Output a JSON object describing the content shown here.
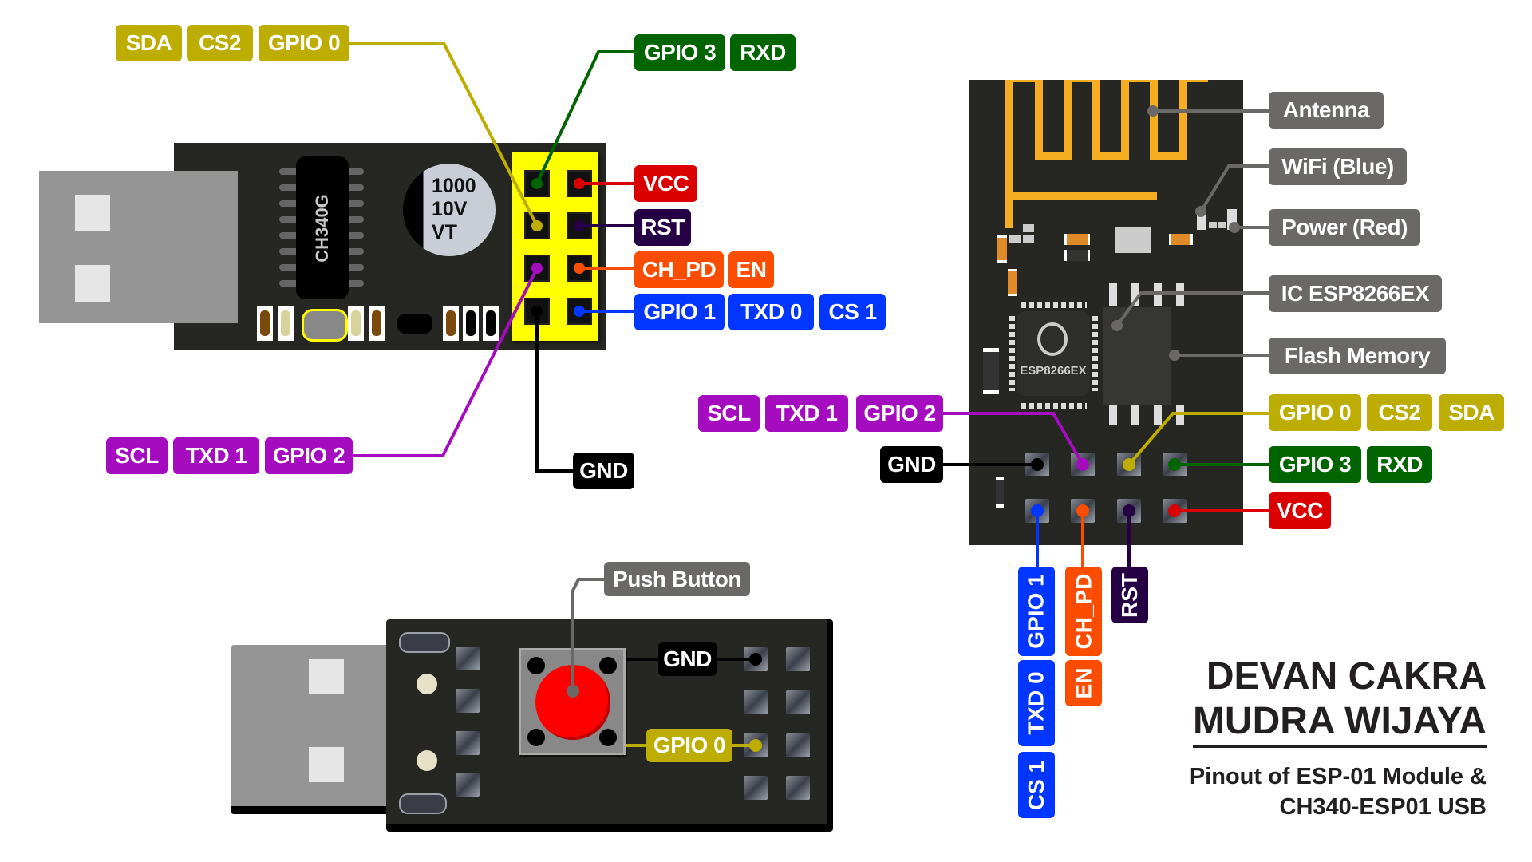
{
  "usb_adapter_top": {
    "chip_label": "CH340G",
    "capacitor_lines": [
      "1000",
      "10V",
      "VT"
    ],
    "labels": {
      "gpio0_group": [
        "SDA",
        "CS2",
        "GPIO 0"
      ],
      "gpio3_group": [
        "GPIO 3",
        "RXD"
      ],
      "vcc": "VCC",
      "rst": "RST",
      "ch_pd_group": [
        "CH_PD",
        "EN"
      ],
      "gpio1_group": [
        "GPIO 1",
        "TXD 0",
        "CS 1"
      ],
      "gpio2_group": [
        "SCL",
        "TXD 1",
        "GPIO 2"
      ],
      "gnd": "GND"
    }
  },
  "usb_adapter_bottom": {
    "labels": {
      "push_button": "Push Button",
      "gnd": "GND",
      "gpio0": "GPIO 0"
    }
  },
  "esp01": {
    "chip_marking": "ESP8266EX",
    "component_labels": {
      "antenna": "Antenna",
      "wifi_led": "WiFi (Blue)",
      "power_led": "Power (Red)",
      "ic": "IC ESP8266EX",
      "flash": "Flash Memory"
    },
    "pin_labels": {
      "gpio2_group": [
        "SCL",
        "TXD 1",
        "GPIO 2"
      ],
      "gnd": "GND",
      "gpio0_group": [
        "GPIO 0",
        "CS2",
        "SDA"
      ],
      "gpio3_group": [
        "GPIO 3",
        "RXD"
      ],
      "vcc": "VCC",
      "gpio1_group": [
        "GPIO 1",
        "TXD 0",
        "CS 1"
      ],
      "ch_pd_group": [
        "CH_PD",
        "EN"
      ],
      "rst": "RST"
    }
  },
  "credits": {
    "author_line1": "DEVAN CAKRA",
    "author_line2": "MUDRA WIJAYA",
    "subtitle_line1": "Pinout of ESP-01 Module &",
    "subtitle_line2": "CH340-ESP01 USB"
  },
  "colors": {
    "gpio0": "#bcad00",
    "gpio3": "#006400",
    "vcc": "#db0000",
    "rst": "#260044",
    "ch_pd": "#fb4d02",
    "gpio1": "#0036ff",
    "gpio2": "#a50cbf",
    "gnd": "#000000",
    "component": "#6b6868",
    "header": "#ffff00",
    "antenna": "#f5ae22"
  }
}
